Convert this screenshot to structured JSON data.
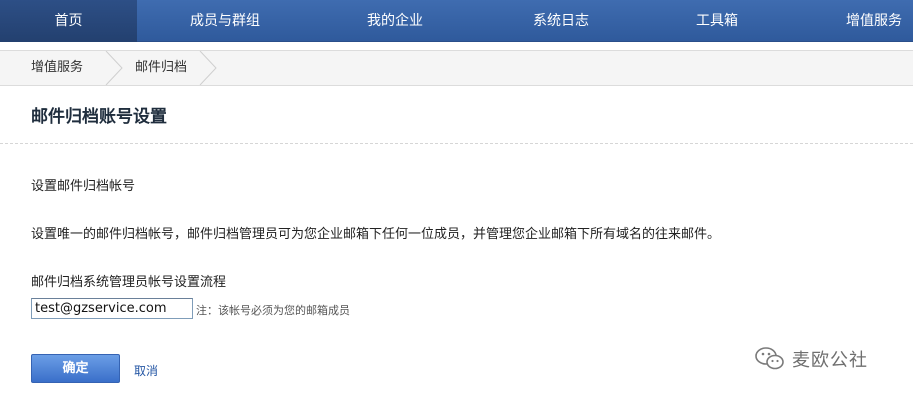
{
  "nav": {
    "items": [
      {
        "label": "首页",
        "active": true
      },
      {
        "label": "成员与群组",
        "active": false
      },
      {
        "label": "我的企业",
        "active": false
      },
      {
        "label": "系统日志",
        "active": false
      },
      {
        "label": "工具箱",
        "active": false
      },
      {
        "label": "增值服务",
        "active": false
      }
    ]
  },
  "breadcrumb": {
    "items": [
      "增值服务",
      "邮件归档"
    ]
  },
  "page": {
    "title": "邮件归档账号设置",
    "section_label": "设置邮件归档帐号",
    "description": "设置唯一的邮件归档帐号，邮件归档管理员可为您企业邮箱下任何一位成员，并管理您企业邮箱下所有域名的往来邮件。",
    "flow_label": "邮件归档系统管理员帐号设置流程",
    "account_input": {
      "value": "test@gzservice.com"
    },
    "note": "注：该帐号必须为您的邮箱成员"
  },
  "actions": {
    "confirm_label": "确定",
    "cancel_label": "取消"
  },
  "watermark": {
    "text": "麦欧公社",
    "icon": "wechat-icon"
  },
  "colors": {
    "nav_bg": "#2f5a9c",
    "nav_active": "#23406f",
    "button_blue": "#3a6fc9",
    "link": "#2456a4"
  }
}
